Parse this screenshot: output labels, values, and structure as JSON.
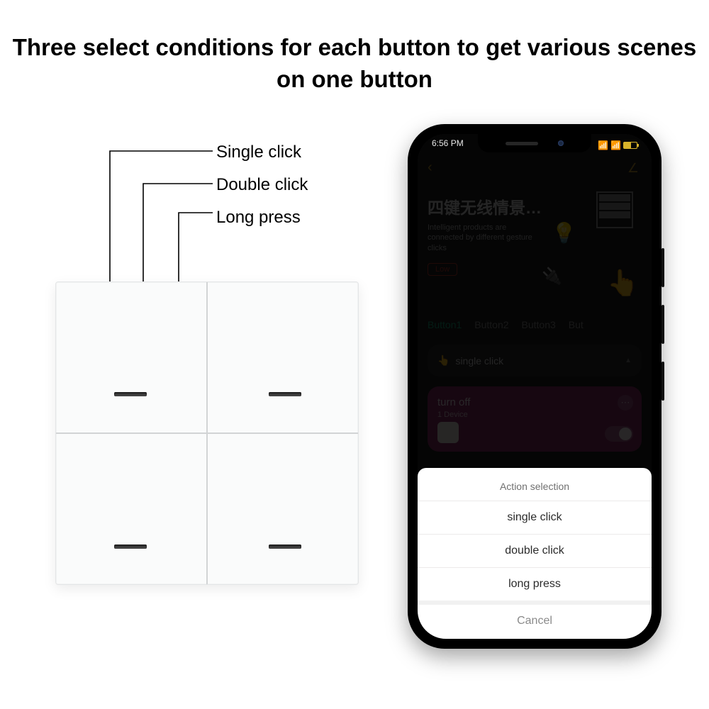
{
  "headline": "Three select conditions for each button to get various scenes on one button",
  "callouts": {
    "single": "Single click",
    "double": "Double click",
    "long": "Long press"
  },
  "phone": {
    "status_time": "6:56 PM",
    "app": {
      "title": "四键无线情景…",
      "subtitle": "Intelligent products are connected by different gesture clicks",
      "battery_label": "Low",
      "tabs": [
        "Button1",
        "Button2",
        "Button3",
        "But"
      ],
      "section_label": "single click",
      "scene": {
        "title": "turn off",
        "subtitle": "1 Device"
      }
    },
    "sheet": {
      "title": "Action selection",
      "options": [
        "single click",
        "double click",
        "long press"
      ],
      "cancel": "Cancel"
    }
  }
}
